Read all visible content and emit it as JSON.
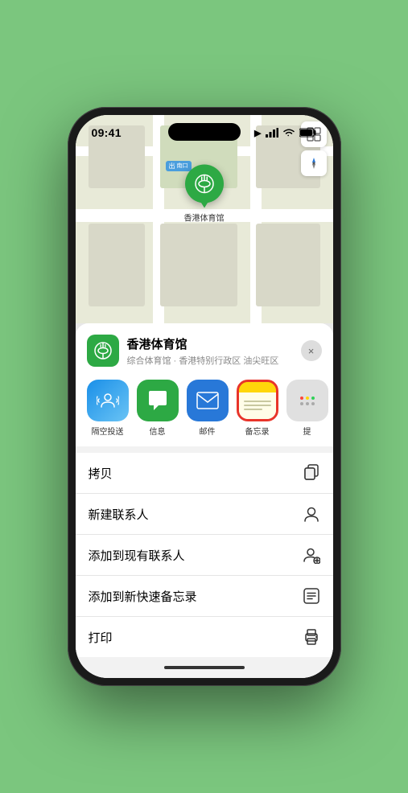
{
  "status": {
    "time": "09:41",
    "location_icon": "▶",
    "signal_bars": "●●●●",
    "wifi": "wifi-icon",
    "battery": "battery-icon"
  },
  "map": {
    "entrance_label": "南口",
    "entrance_prefix": "出",
    "pin_name": "香港体育馆"
  },
  "venue": {
    "name": "香港体育馆",
    "description": "综合体育馆 · 香港特别行政区 油尖旺区",
    "close_label": "×"
  },
  "apps": [
    {
      "id": "airdrop",
      "label": "隔空投送",
      "icon_type": "airdrop"
    },
    {
      "id": "messages",
      "label": "信息",
      "icon_type": "messages"
    },
    {
      "id": "mail",
      "label": "邮件",
      "icon_type": "mail"
    },
    {
      "id": "notes",
      "label": "备忘录",
      "icon_type": "notes",
      "selected": true
    },
    {
      "id": "more",
      "label": "提",
      "icon_type": "more"
    }
  ],
  "actions": [
    {
      "id": "copy",
      "label": "拷贝",
      "icon": "📋"
    },
    {
      "id": "new-contact",
      "label": "新建联系人",
      "icon": "👤"
    },
    {
      "id": "add-contact",
      "label": "添加到现有联系人",
      "icon": "👤+"
    },
    {
      "id": "add-notes",
      "label": "添加到新快速备忘录",
      "icon": "📝"
    },
    {
      "id": "print",
      "label": "打印",
      "icon": "🖨"
    }
  ]
}
